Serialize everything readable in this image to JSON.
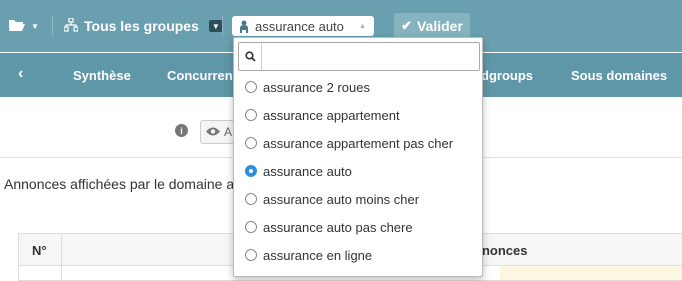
{
  "toolbar": {
    "folder_icon": "folder-open-icon",
    "groups_label": "Tous les groupes",
    "keyword_selected": "assurance auto",
    "validate_label": "Valider"
  },
  "tabs": {
    "items": [
      {
        "label": "Synthèse"
      },
      {
        "label": "Concurrents"
      },
      {
        "label": "dgroups"
      },
      {
        "label": "Sous domaines"
      }
    ]
  },
  "content": {
    "view_button_text": "A",
    "annonces_text": "Annonces affichées par le domaine a",
    "table_headers": [
      "N°",
      "nnonces"
    ]
  },
  "dropdown": {
    "search_placeholder": "",
    "options": [
      {
        "label": "assurance 2 roues",
        "checked": false
      },
      {
        "label": "assurance appartement",
        "checked": false
      },
      {
        "label": "assurance appartement pas cher",
        "checked": false
      },
      {
        "label": "assurance auto",
        "checked": true
      },
      {
        "label": "assurance auto moins cher",
        "checked": false
      },
      {
        "label": "assurance auto pas chere",
        "checked": false
      },
      {
        "label": "assurance en ligne",
        "checked": false
      }
    ]
  },
  "colors": {
    "toolbar_bg": "#6a9faf",
    "tabs_bg": "#5f97a8",
    "radio_checked": "#2d8ee0"
  }
}
